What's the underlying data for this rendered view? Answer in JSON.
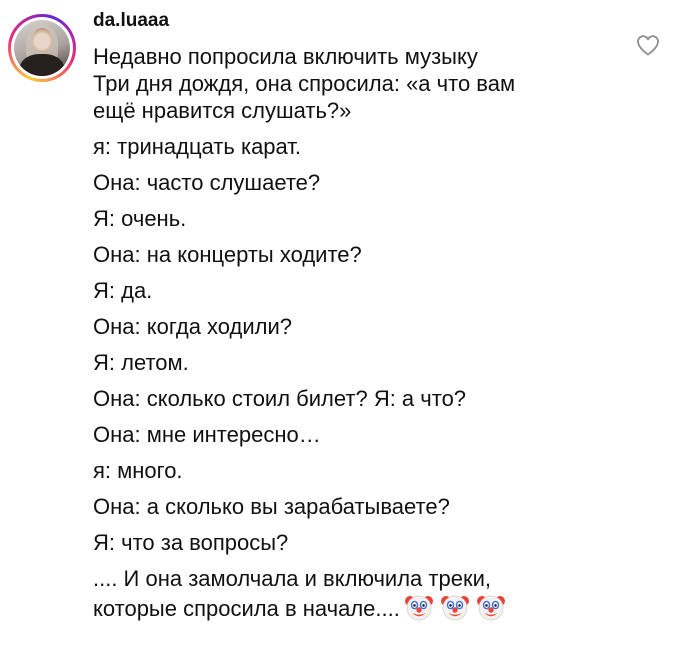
{
  "comment": {
    "username": "da.luaaa",
    "intro_lines": [
      "Недавно попросила включить музыку",
      "Три дня дождя, она спросила: «а что вам",
      "ещё нравится слушать?»"
    ],
    "dialogue": [
      "я: тринадцать карат.",
      "Она: часто слушаете?",
      "Я: очень.",
      "Она: на концерты ходите?",
      "Я: да.",
      "Она: когда ходили?",
      "Я: летом.",
      "Она: сколько стоил билет? Я: а что?",
      "Она: мне интересно…",
      "я: много.",
      "Она: а сколько вы зарабатываете?",
      "Я: что за вопросы?"
    ],
    "closing_lines": [
      ".... И она замолчала и включила треки,",
      "которые спросила в начале...."
    ],
    "emojis": [
      "clown-emoji",
      "clown-emoji",
      "clown-emoji"
    ]
  },
  "icons": {
    "like": "heart-outline-icon"
  },
  "colors": {
    "text": "#111111",
    "icon": "#8e8e8e",
    "story_ring": [
      "#f9ce34",
      "#ee2a7b",
      "#6228d7"
    ]
  }
}
